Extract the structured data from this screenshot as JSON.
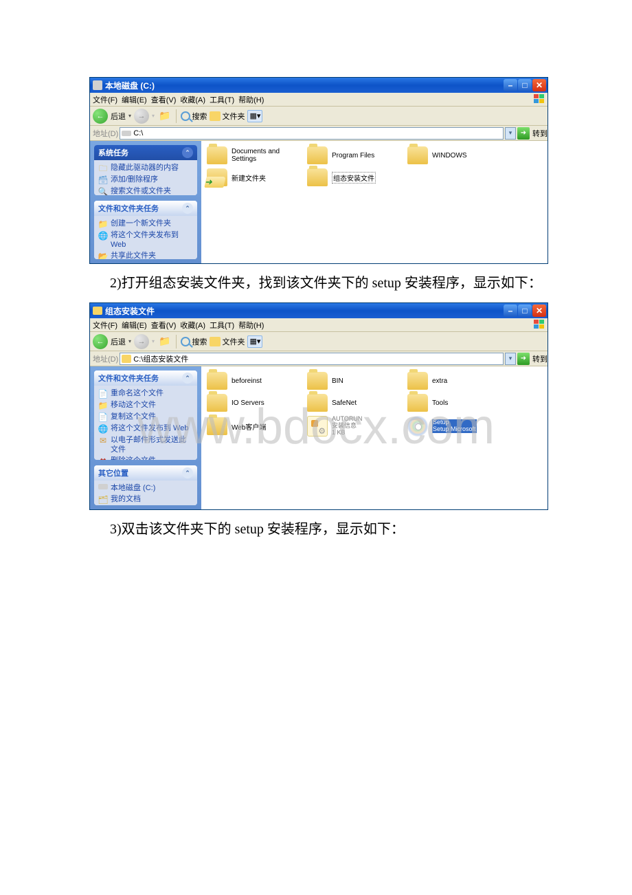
{
  "watermark": "www.bdocx.com",
  "win1": {
    "title": "本地磁盘 (C:)",
    "menu": [
      "文件(F)",
      "编辑(E)",
      "查看(V)",
      "收藏(A)",
      "工具(T)",
      "帮助(H)"
    ],
    "toolbar": {
      "back": "后退",
      "search": "搜索",
      "folders": "文件夹"
    },
    "address": {
      "label": "地址(D)",
      "path": "C:\\",
      "go": "转到"
    },
    "sidebar": {
      "panel1": {
        "title": "系统任务",
        "items": [
          "隐藏此驱动器的内容",
          "添加/删除程序",
          "搜索文件或文件夹"
        ]
      },
      "panel2": {
        "title": "文件和文件夹任务",
        "items": [
          "创建一个新文件夹",
          "将这个文件夹发布到 Web",
          "共享此文件夹"
        ]
      }
    },
    "items": [
      {
        "name": "Documents and Settings"
      },
      {
        "name": "Program Files"
      },
      {
        "name": "WINDOWS"
      },
      {
        "name": "新建文件夹"
      },
      {
        "name": "组态安装文件"
      }
    ]
  },
  "text2": "2)打开组态安装文件夹，找到该文件夹下的 setup 安装程序，显示如下：",
  "win2": {
    "title": "组态安装文件",
    "menu": [
      "文件(F)",
      "编辑(E)",
      "查看(V)",
      "收藏(A)",
      "工具(T)",
      "帮助(H)"
    ],
    "toolbar": {
      "back": "后退",
      "search": "搜索",
      "folders": "文件夹"
    },
    "address": {
      "label": "地址(D)",
      "path": "C:\\组态安装文件",
      "go": "转到"
    },
    "sidebar": {
      "panel1": {
        "title": "文件和文件夹任务",
        "items": [
          "重命名这个文件",
          "移动这个文件",
          "复制这个文件",
          "将这个文件发布到 Web",
          "以电子邮件形式发送此文件",
          "删除这个文件"
        ]
      },
      "panel2": {
        "title": "其它位置",
        "items": [
          "本地磁盘 (C:)",
          "我的文档"
        ]
      }
    },
    "items": [
      {
        "name": "beforeinst"
      },
      {
        "name": "BIN"
      },
      {
        "name": "extra"
      },
      {
        "name": "IO Servers"
      },
      {
        "name": "SafeNet"
      },
      {
        "name": "Tools"
      },
      {
        "name": "Web客户端"
      },
      {
        "name": "AUTORUN",
        "sub1": "安装信息",
        "sub2": "1 KB"
      },
      {
        "name": "Setup",
        "sub": "Setup Microsoft"
      }
    ]
  },
  "text3": "3)双击该文件夹下的 setup 安装程序，显示如下："
}
